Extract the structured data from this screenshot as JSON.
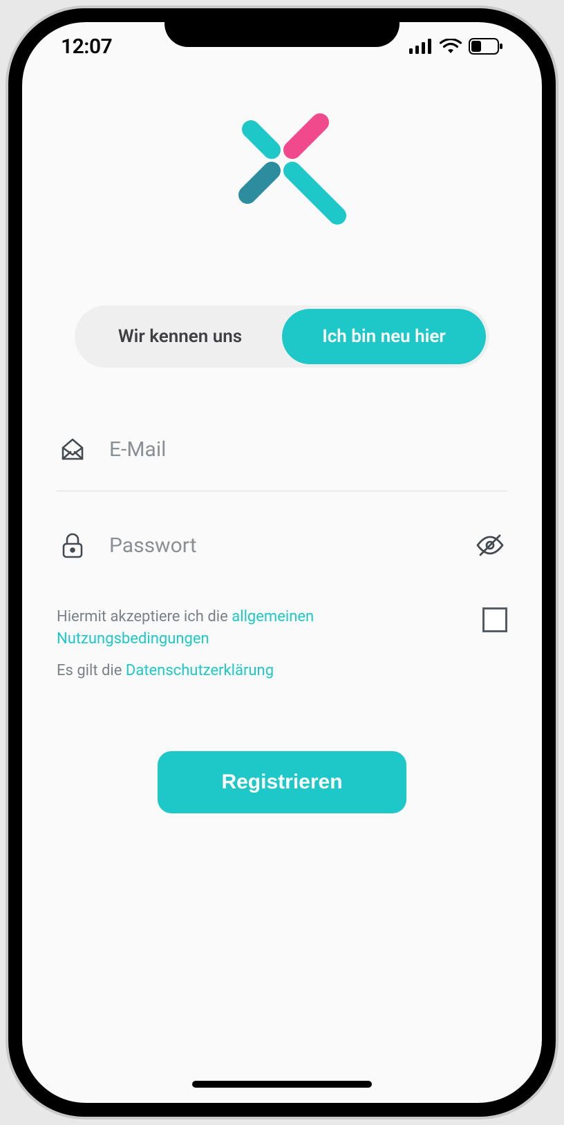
{
  "status": {
    "time": "12:07"
  },
  "tabs": {
    "login_label": "Wir kennen uns",
    "signup_label": "Ich bin neu hier"
  },
  "form": {
    "email_placeholder": "E-Mail",
    "password_placeholder": "Passwort"
  },
  "terms": {
    "prefix": "Hiermit akzeptiere ich die ",
    "link1": "allgemeinen Nutzungsbedingungen",
    "line2_prefix": "Es gilt die ",
    "link2": "Datenschutzerklärung"
  },
  "actions": {
    "register_label": "Registrieren"
  },
  "colors": {
    "accent": "#1ec8c8",
    "pink": "#f04a8c",
    "teal_dark": "#2b8d9e"
  }
}
